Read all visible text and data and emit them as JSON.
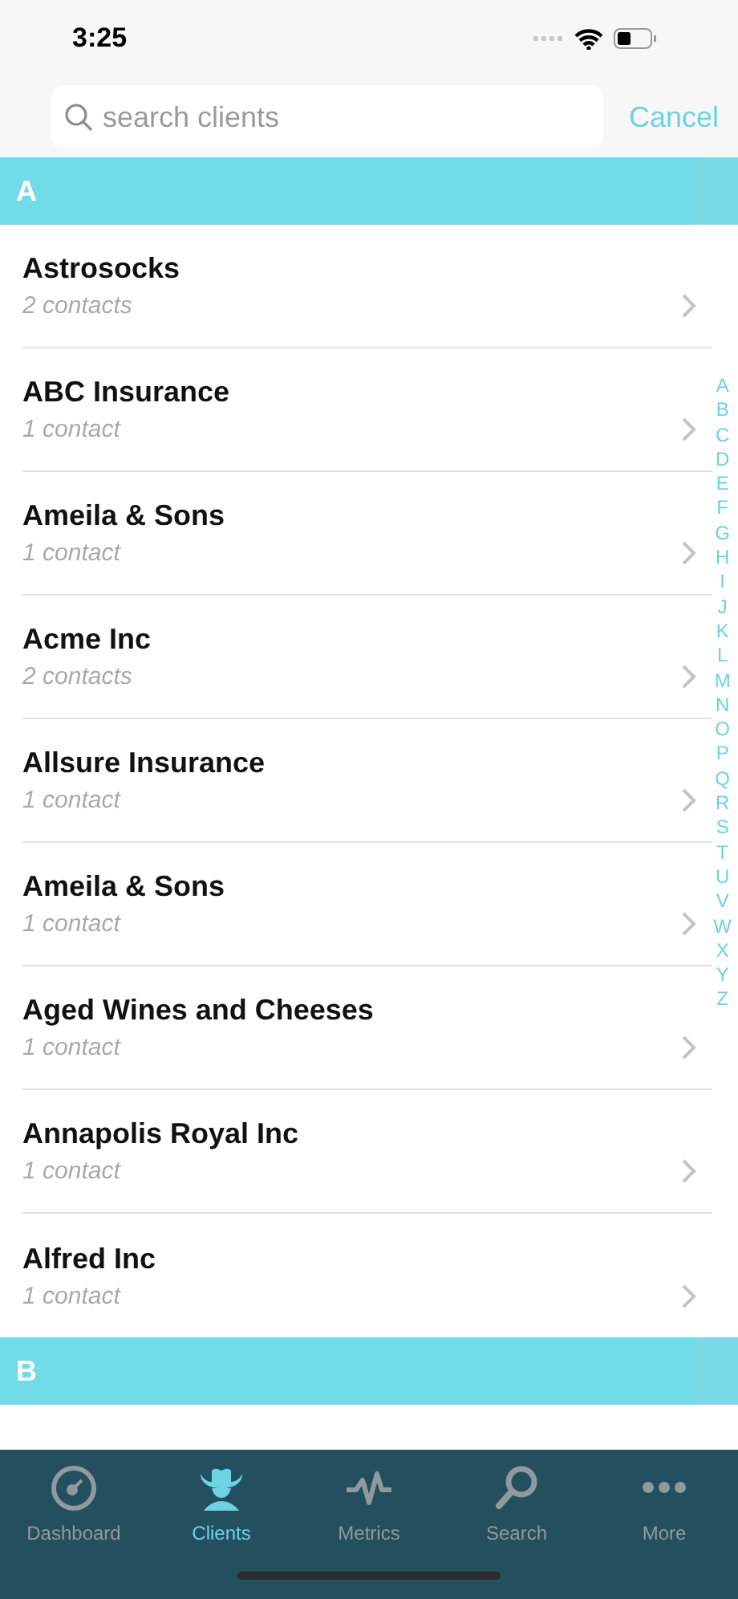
{
  "status_bar": {
    "time": "3:25"
  },
  "search": {
    "placeholder": "search clients",
    "cancel": "Cancel"
  },
  "sections": [
    {
      "letter": "A",
      "clients": [
        {
          "name": "Astrosocks",
          "contacts": "2 contacts"
        },
        {
          "name": "ABC Insurance",
          "contacts": "1 contact"
        },
        {
          "name": "Ameila & Sons",
          "contacts": "1 contact"
        },
        {
          "name": "Acme Inc",
          "contacts": "2 contacts"
        },
        {
          "name": "Allsure Insurance",
          "contacts": "1 contact"
        },
        {
          "name": "Ameila & Sons",
          "contacts": "1 contact"
        },
        {
          "name": "Aged Wines and Cheeses",
          "contacts": "1 contact"
        },
        {
          "name": "Annapolis Royal Inc",
          "contacts": "1 contact"
        },
        {
          "name": "Alfred Inc",
          "contacts": "1 contact"
        }
      ]
    },
    {
      "letter": "B"
    }
  ],
  "index": [
    "A",
    "B",
    "C",
    "D",
    "E",
    "F",
    "G",
    "H",
    "I",
    "J",
    "K",
    "L",
    "M",
    "N",
    "O",
    "P",
    "Q",
    "R",
    "S",
    "T",
    "U",
    "V",
    "W",
    "X",
    "Y",
    "Z"
  ],
  "tab_bar": [
    {
      "kind": "dashboard",
      "label": "Dashboard",
      "selected": false
    },
    {
      "kind": "clients",
      "label": "Clients",
      "selected": true
    },
    {
      "kind": "metrics",
      "label": "Metrics",
      "selected": false
    },
    {
      "kind": "search",
      "label": "Search",
      "selected": false
    },
    {
      "kind": "more",
      "label": "More",
      "selected": false
    }
  ]
}
